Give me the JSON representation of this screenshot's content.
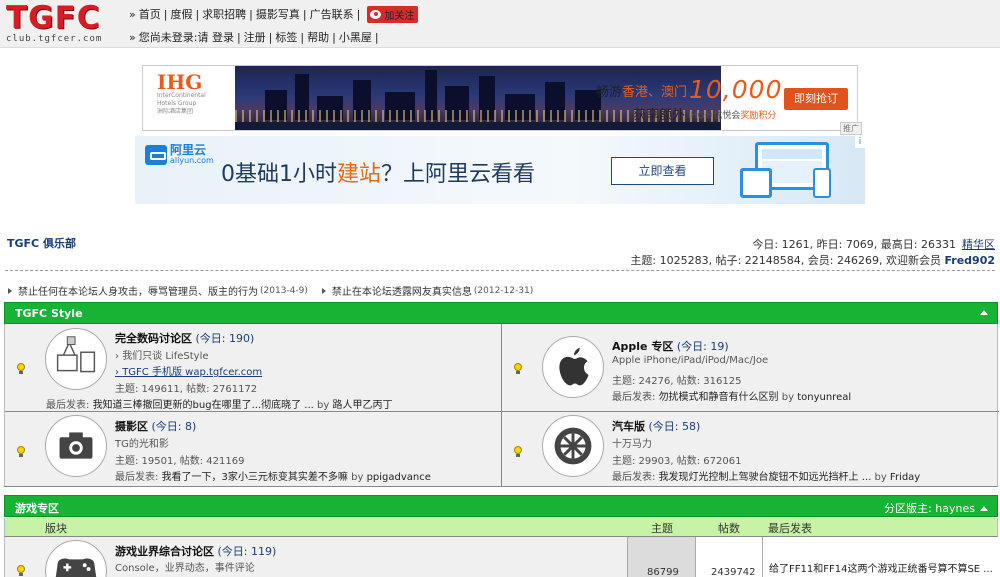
{
  "logo": {
    "text": "TGFC",
    "domain": "club.tgfcer.com"
  },
  "nav": {
    "row1": [
      "首页",
      "度假",
      "求职招聘",
      "摄影写真",
      "广告联系"
    ],
    "follow": "加关注",
    "row2_prefix": "您尚未登录:请",
    "row2": [
      "登录",
      "注册",
      "标签",
      "帮助",
      "小黑屋"
    ]
  },
  "ad_ihg": {
    "brand": "IHG",
    "brand_sub": "InterContinental Hotels Group",
    "brand_cn": "洲际酒店集团",
    "line1_a": "畅游",
    "line1_b": "香港、澳门",
    "number": "10,000",
    "line2": "获享额外",
    "points_a": "IHG®优悦会",
    "points_b": "奖励积分",
    "button": "即刻抢订",
    "tag": "推广"
  },
  "ad_aliyun": {
    "brand": "阿里云",
    "url": "aliyun.com",
    "headline_a": "0基础1小时",
    "headline_b": "建站",
    "headline_c": "？上阿里云看看",
    "button": "立即查看",
    "info": "i"
  },
  "site": {
    "crumb": "TGFC 俱乐部",
    "stats_today": "今日: 1261, 昨日: 7069, 最高日: 26331",
    "essence": "精华区",
    "stats_totals": "主题: 1025283, 帖子: 22148584, 会员: 246269, 欢迎新会员",
    "new_member": "Fred902"
  },
  "notices": [
    {
      "text": "禁止任何在本论坛人身攻击，辱骂管理员、版主的行为",
      "date": "(2013-4-9)"
    },
    {
      "text": "禁止在本论坛透露网友真实信息",
      "date": "(2012-12-31)"
    }
  ],
  "section_style": {
    "title": "TGFC Style"
  },
  "boards": [
    {
      "name": "完全数码讨论区",
      "count": "(今日: 190)",
      "desc": [
        "我们只谈 LifeStyle"
      ],
      "link": "TGFC 手机版 wap.tgfcer.com",
      "stats": "主题: 149611, 帖数: 2761172",
      "last_label": "最后发表:",
      "last_title": "我知道三棒撤回更新的bug在哪里了...彻底晓了 ...",
      "last_by": "by",
      "last_user": "路人甲乙丙丁",
      "icon": "digital-icon"
    },
    {
      "name": "Apple 专区",
      "count": "(今日: 19)",
      "desc": [
        "Apple iPhone/iPad/iPod/Mac/Joe"
      ],
      "link": "",
      "stats": "主题: 24276, 帖数: 316125",
      "last_label": "最后发表:",
      "last_title": "勿扰模式和静音有什么区别",
      "last_by": "by",
      "last_user": "tonyunreal",
      "icon": "apple-icon"
    },
    {
      "name": "摄影区",
      "count": "(今日: 8)",
      "desc": [
        "TG的光和影"
      ],
      "link": "",
      "stats": "主题: 19501, 帖数: 421169",
      "last_label": "最后发表:",
      "last_title": "我看了一下，3家小三元标变其实差不多嘛",
      "last_by": "by",
      "last_user": "ppigadvance",
      "icon": "camera-icon"
    },
    {
      "name": "汽车版",
      "count": "(今日: 58)",
      "desc": [
        "十万马力"
      ],
      "link": "",
      "stats": "主题: 29903, 帖数: 672061",
      "last_label": "最后发表:",
      "last_title": "我发现灯光控制上驾驶台旋钮不如远光挡杆上 ...",
      "last_by": "by",
      "last_user": "Friday",
      "icon": "wheel-icon"
    }
  ],
  "section_games": {
    "title": "游戏专区",
    "moderator_label": "分区版主:",
    "moderator": "haynes"
  },
  "games_table": {
    "headers": [
      "版块",
      "主题",
      "帖数",
      "最后发表"
    ],
    "row": {
      "name": "游戏业界综合讨论区",
      "count": "(今日: 119)",
      "desc": "Console，业界动态，事件评论",
      "topics": "86799",
      "posts": "2439742",
      "last": "给了FF11和FF14这两个游戏正统番号算不算SE ..."
    }
  }
}
